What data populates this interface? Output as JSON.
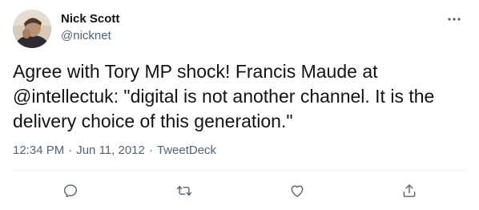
{
  "author": {
    "display_name": "Nick Scott",
    "handle": "@nicknet"
  },
  "tweet": {
    "text": "Agree with Tory MP shock! Francis Maude at @intellectuk: \"digital is not another channel. It is the delivery choice of this generation.\"",
    "time": "12:34 PM",
    "separator": "·",
    "date": "Jun 11, 2012",
    "source": "TweetDeck"
  },
  "icons": {
    "more": "more-horizontal-icon",
    "reply": "reply-icon",
    "retweet": "retweet-icon",
    "like": "heart-icon",
    "share": "share-icon"
  },
  "colors": {
    "text_primary": "#0f1419",
    "text_secondary": "#536471",
    "divider": "#eff3f4",
    "icon": "#536471"
  }
}
